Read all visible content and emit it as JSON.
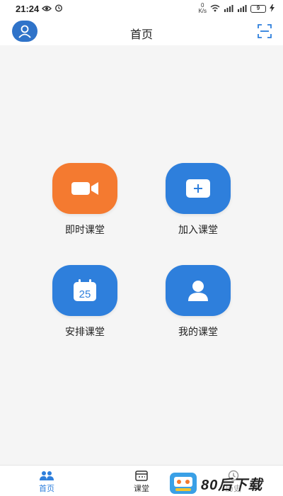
{
  "status_bar": {
    "time": "21:24",
    "net_speed_value": "0",
    "net_speed_unit": "K/s",
    "battery": "9"
  },
  "header": {
    "title": "首页"
  },
  "actions": [
    {
      "label": "即时课堂",
      "icon": "video-camera-icon",
      "color": "#f47a30"
    },
    {
      "label": "加入课堂",
      "icon": "plus-icon",
      "color": "#2e7fdc"
    },
    {
      "label": "安排课堂",
      "icon": "calendar-icon",
      "color": "#2e7fdc",
      "icon_text": "25"
    },
    {
      "label": "我的课堂",
      "icon": "person-icon",
      "color": "#2e7fdc"
    }
  ],
  "bottom_nav": {
    "items": [
      {
        "label": "首页",
        "icon": "home-users-icon",
        "active": true
      },
      {
        "label": "课堂",
        "icon": "classroom-icon",
        "active": false
      },
      {
        "label": "历史",
        "icon": "history-icon",
        "active": false
      }
    ]
  },
  "watermark": {
    "text": "80后下载"
  },
  "colors": {
    "primary_blue": "#2e7fdc",
    "accent_orange": "#f47a30",
    "background": "#f5f5f5"
  }
}
